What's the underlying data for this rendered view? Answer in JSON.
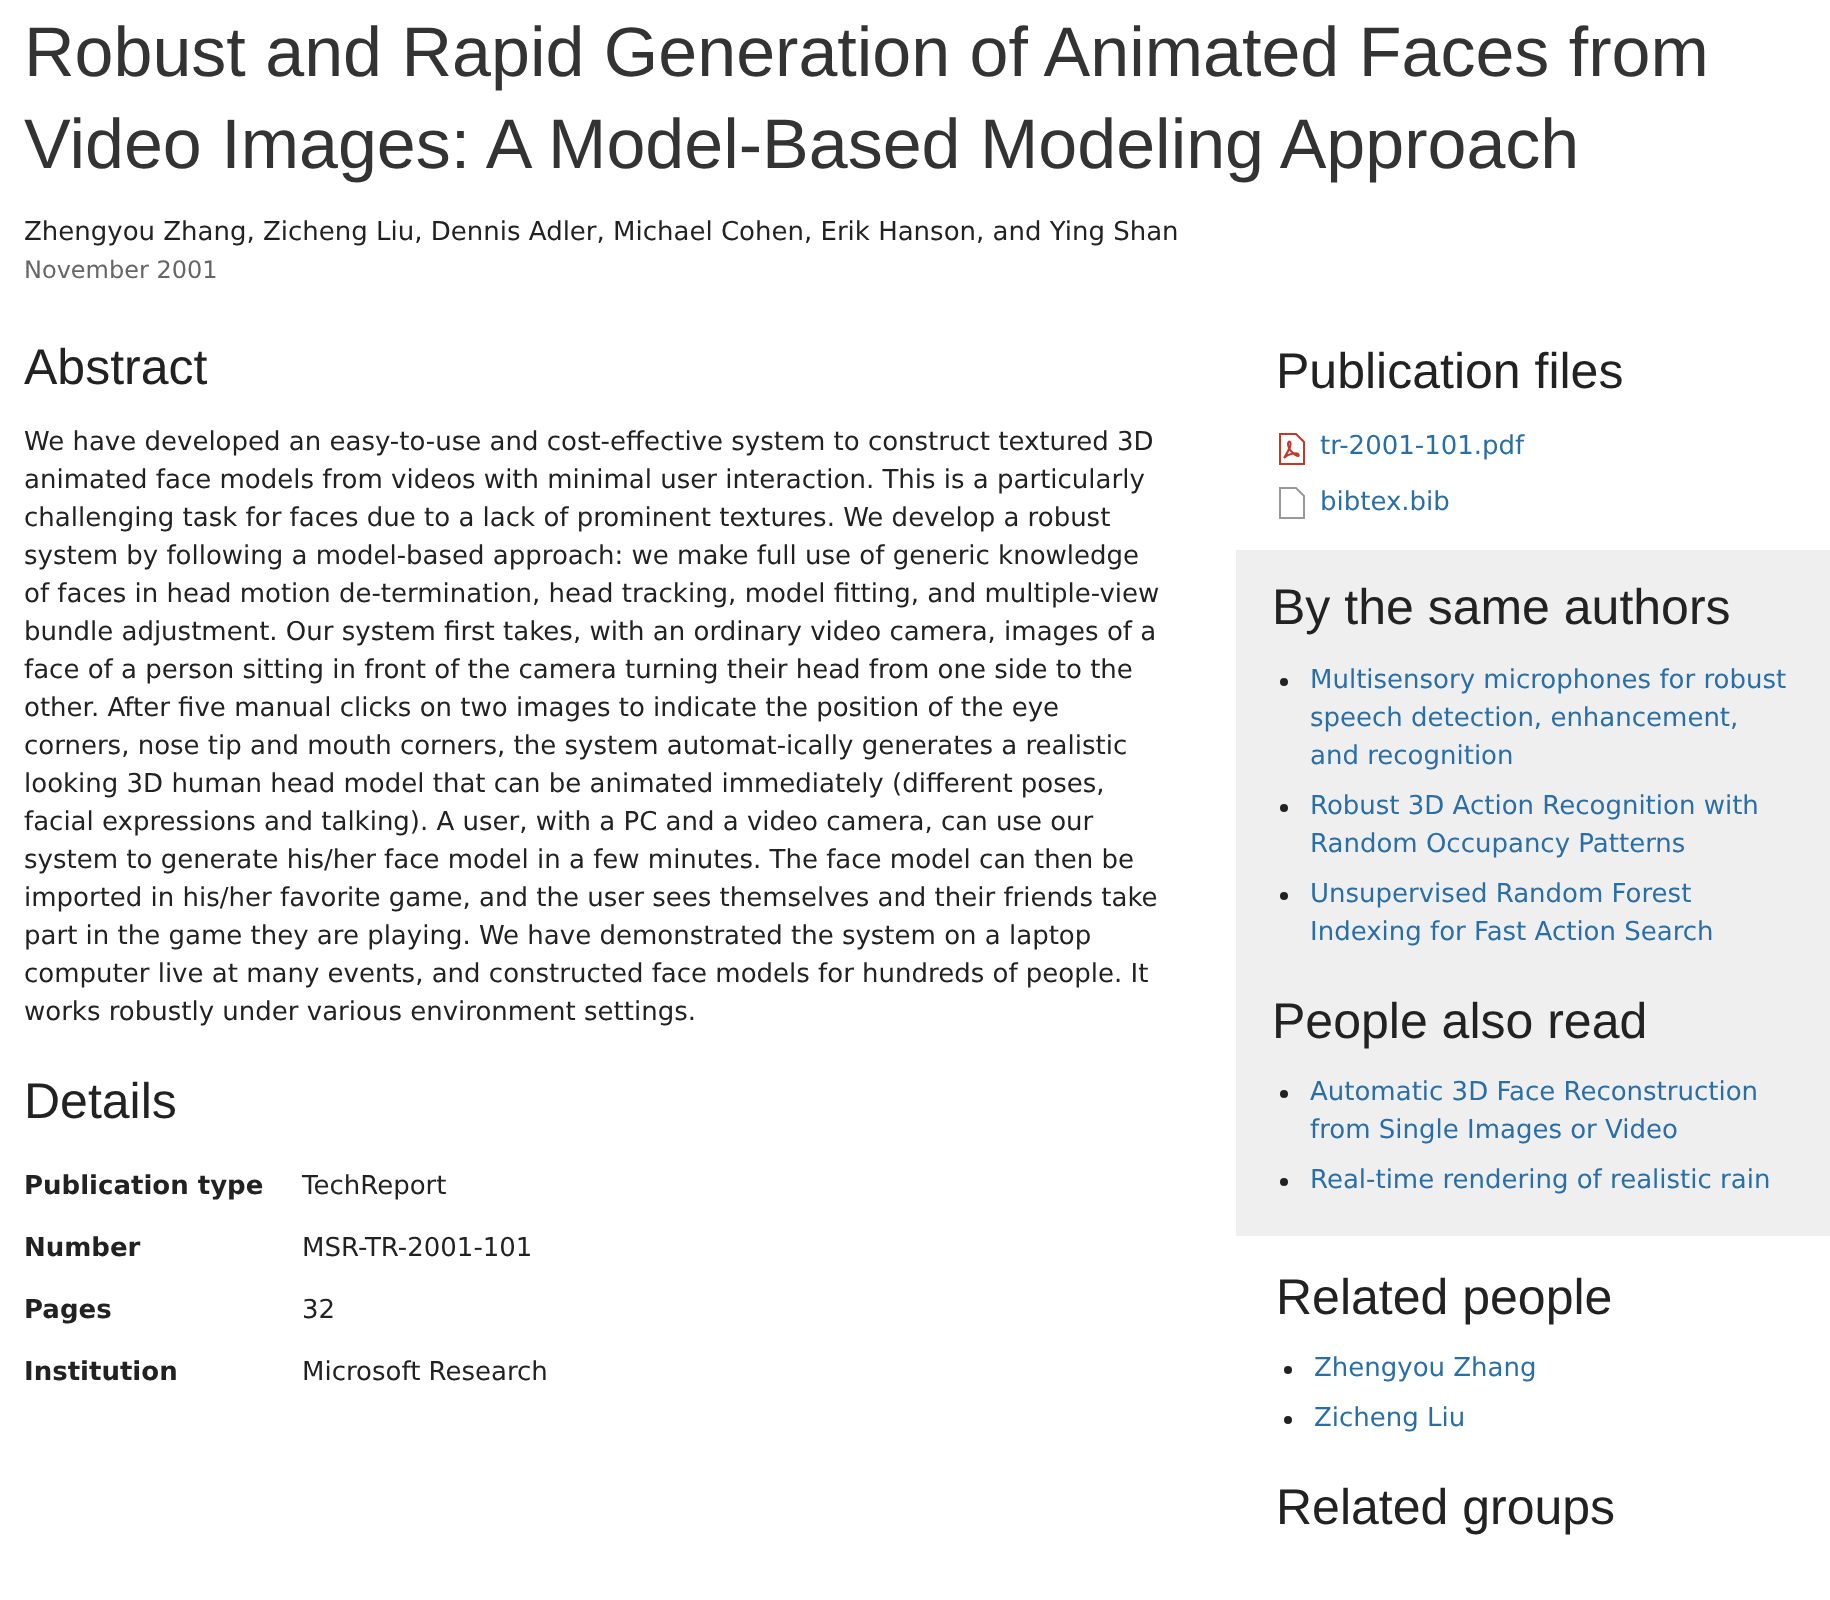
{
  "title": "Robust and Rapid Generation of Animated Faces from Video Images: A Model-Based Modeling Approach",
  "authors": "Zhengyou Zhang, Zicheng Liu, Dennis Adler, Michael Cohen, Erik Hanson, and Ying Shan",
  "date": "November 2001",
  "abstract": {
    "heading": "Abstract",
    "text": "We have developed an easy-to-use and cost-effective system to construct textured 3D animated face models from videos with minimal user interaction. This is a particularly challenging task for faces due to a lack of prominent textures. We develop a robust system by following a model-based approach: we make full use of generic knowledge of faces in head motion de-termination, head tracking, model fitting, and multiple-view bundle adjustment. Our system first takes, with an ordinary video camera, images of a face of a person sitting in front of the camera turning their head from one side to the other. After five manual clicks on two images to indicate the position of the eye corners, nose tip and mouth corners, the system automat-ically generates a realistic looking 3D human head model that can be animated immediately (different poses, facial expressions and talking). A user, with a PC and a video camera, can use our system to generate his/her face model in a few minutes. The face model can then be imported in his/her favorite game, and the user sees themselves and their friends take part in the game they are playing. We have demonstrated the system on a laptop computer live at many events, and constructed face models for hundreds of people. It works robustly under various environment settings."
  },
  "details": {
    "heading": "Details",
    "rows": [
      {
        "label": "Publication type",
        "value": "TechReport"
      },
      {
        "label": "Number",
        "value": "MSR-TR-2001-101"
      },
      {
        "label": "Pages",
        "value": "32"
      },
      {
        "label": "Institution",
        "value": "Microsoft Research"
      }
    ]
  },
  "publication_files": {
    "heading": "Publication files",
    "files": [
      {
        "kind": "pdf",
        "name": "tr-2001-101.pdf"
      },
      {
        "kind": "file",
        "name": "bibtex.bib"
      }
    ]
  },
  "by_the_same_authors": {
    "heading": "By the same authors",
    "items": [
      "Multisensory microphones for robust speech detection, enhancement, and recognition",
      "Robust 3D Action Recognition with Random Occupancy Patterns",
      "Unsupervised Random Forest Indexing for Fast Action Search"
    ]
  },
  "people_also_read": {
    "heading": "People also read",
    "items": [
      "Automatic 3D Face Reconstruction from Single Images or Video",
      "Real-time rendering of realistic rain"
    ]
  },
  "related_people": {
    "heading": "Related people",
    "items": [
      "Zhengyou Zhang",
      "Zicheng Liu"
    ]
  },
  "related_groups": {
    "heading": "Related groups"
  }
}
